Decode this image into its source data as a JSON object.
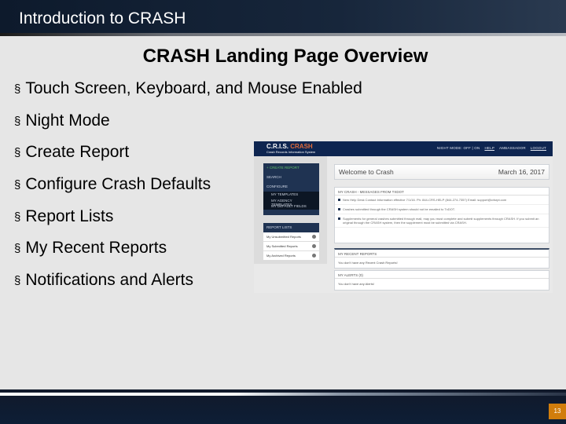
{
  "header": {
    "title": "Introduction to CRASH"
  },
  "slide": {
    "title": "CRASH Landing Page Overview",
    "bullet_marker": "§",
    "bullets": [
      "Touch Screen, Keyboard, and Mouse Enabled",
      "Night Mode",
      "Create Report",
      "Configure Crash Defaults",
      "Report Lists",
      "My Recent Reports",
      "Notifications and Alerts"
    ]
  },
  "screenshot": {
    "logo": "C.R.I.S.",
    "logo_accent": "CRASH",
    "logo_sub": "Crash Records Information System",
    "topnav": {
      "night_mode": "NIGHT MODE: OFF | ON",
      "help": "HELP",
      "user": "AMBASSADOR",
      "logout": "LOGOUT"
    },
    "nav": {
      "create": "+ CREATE REPORT",
      "search": "SEARCH",
      "configure": "CONFIGURE",
      "sub": [
        "MY TEMPLATES",
        "MY AGENCY TEMPLATES",
        "MY DEFAULT FIELDS"
      ]
    },
    "report_lists": {
      "header": "REPORT LISTS",
      "items": [
        "My Unsubmitted Reports",
        "My Submitted Reports",
        "My Archived Reports"
      ]
    },
    "welcome": "Welcome to Crash",
    "date": "March 16, 2017",
    "messages_header": "MY CRASH - MESSAGES FROM TXDOT",
    "messages": [
      "New Help Desk Contact Information effective 7/1/16. Ph: 844-CRS-HELP (844-274-7357) Email: support@crisrpt.com",
      "Crashes submitted through the CRASH system should not be emailed to TxDOT.",
      "Supplements for general crashes submitted through mail, may you must complete and submit supplements through CRASH. If you submit an original through the CRASH system, then the supplement must be submitted via CRASH."
    ],
    "recent_header": "MY RECENT REPORTS",
    "recent_empty": "You don't have any Recent Crash Reports!",
    "alerts_header": "MY ALERTS (0)",
    "alerts_empty": "You don't have any Alerts!"
  },
  "footer": {
    "page_number": "13"
  },
  "colors": {
    "accent": "#d17d0c",
    "navy": "#0e2550"
  }
}
